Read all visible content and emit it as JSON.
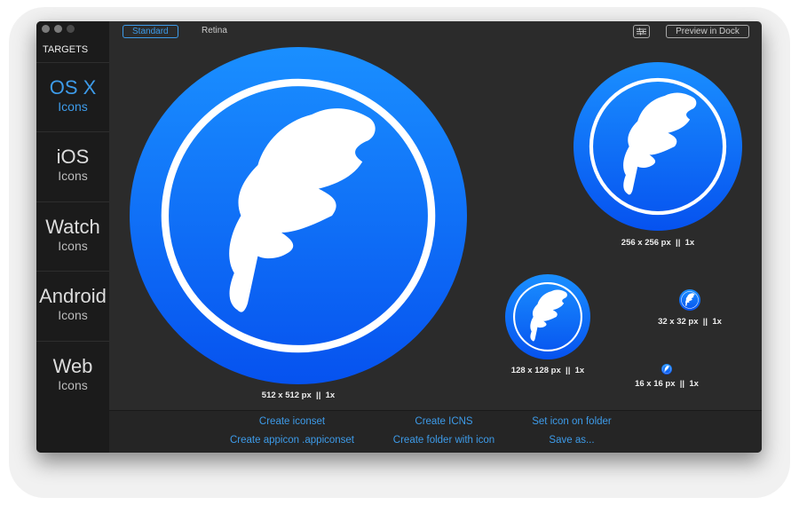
{
  "window": {
    "traffic_lights": [
      "close",
      "minimize",
      "zoom"
    ]
  },
  "sidebar": {
    "header": "TARGETS",
    "items": [
      {
        "title": "OS X",
        "subtitle": "Icons",
        "active": true
      },
      {
        "title": "iOS",
        "subtitle": "Icons"
      },
      {
        "title": "Watch",
        "subtitle": "Icons"
      },
      {
        "title": "Android",
        "subtitle": "Icons"
      },
      {
        "title": "Web",
        "subtitle": "Icons"
      }
    ]
  },
  "toolbar": {
    "modes": [
      "Standard",
      "Retina"
    ],
    "selected_mode": "Standard",
    "settings_icon": "sliders-icon",
    "preview_label": "Preview in Dock"
  },
  "icons": [
    {
      "label": "512 x 512 px  ||  1x"
    },
    {
      "label": "256 x 256 px  ||  1x"
    },
    {
      "label": "128 x 128 px  ||  1x"
    },
    {
      "label": "32 x 32 px  ||  1x"
    },
    {
      "label": "16 x 16 px  ||  1x"
    }
  ],
  "actions": [
    "Create iconset",
    "Create ICNS",
    "Set icon on folder",
    "Create appicon .appiconset",
    "Create folder with icon",
    "Save as..."
  ],
  "colors": {
    "accent": "#3d9be9",
    "icon_top": "#1a8cff",
    "icon_bottom": "#0a55f0"
  }
}
